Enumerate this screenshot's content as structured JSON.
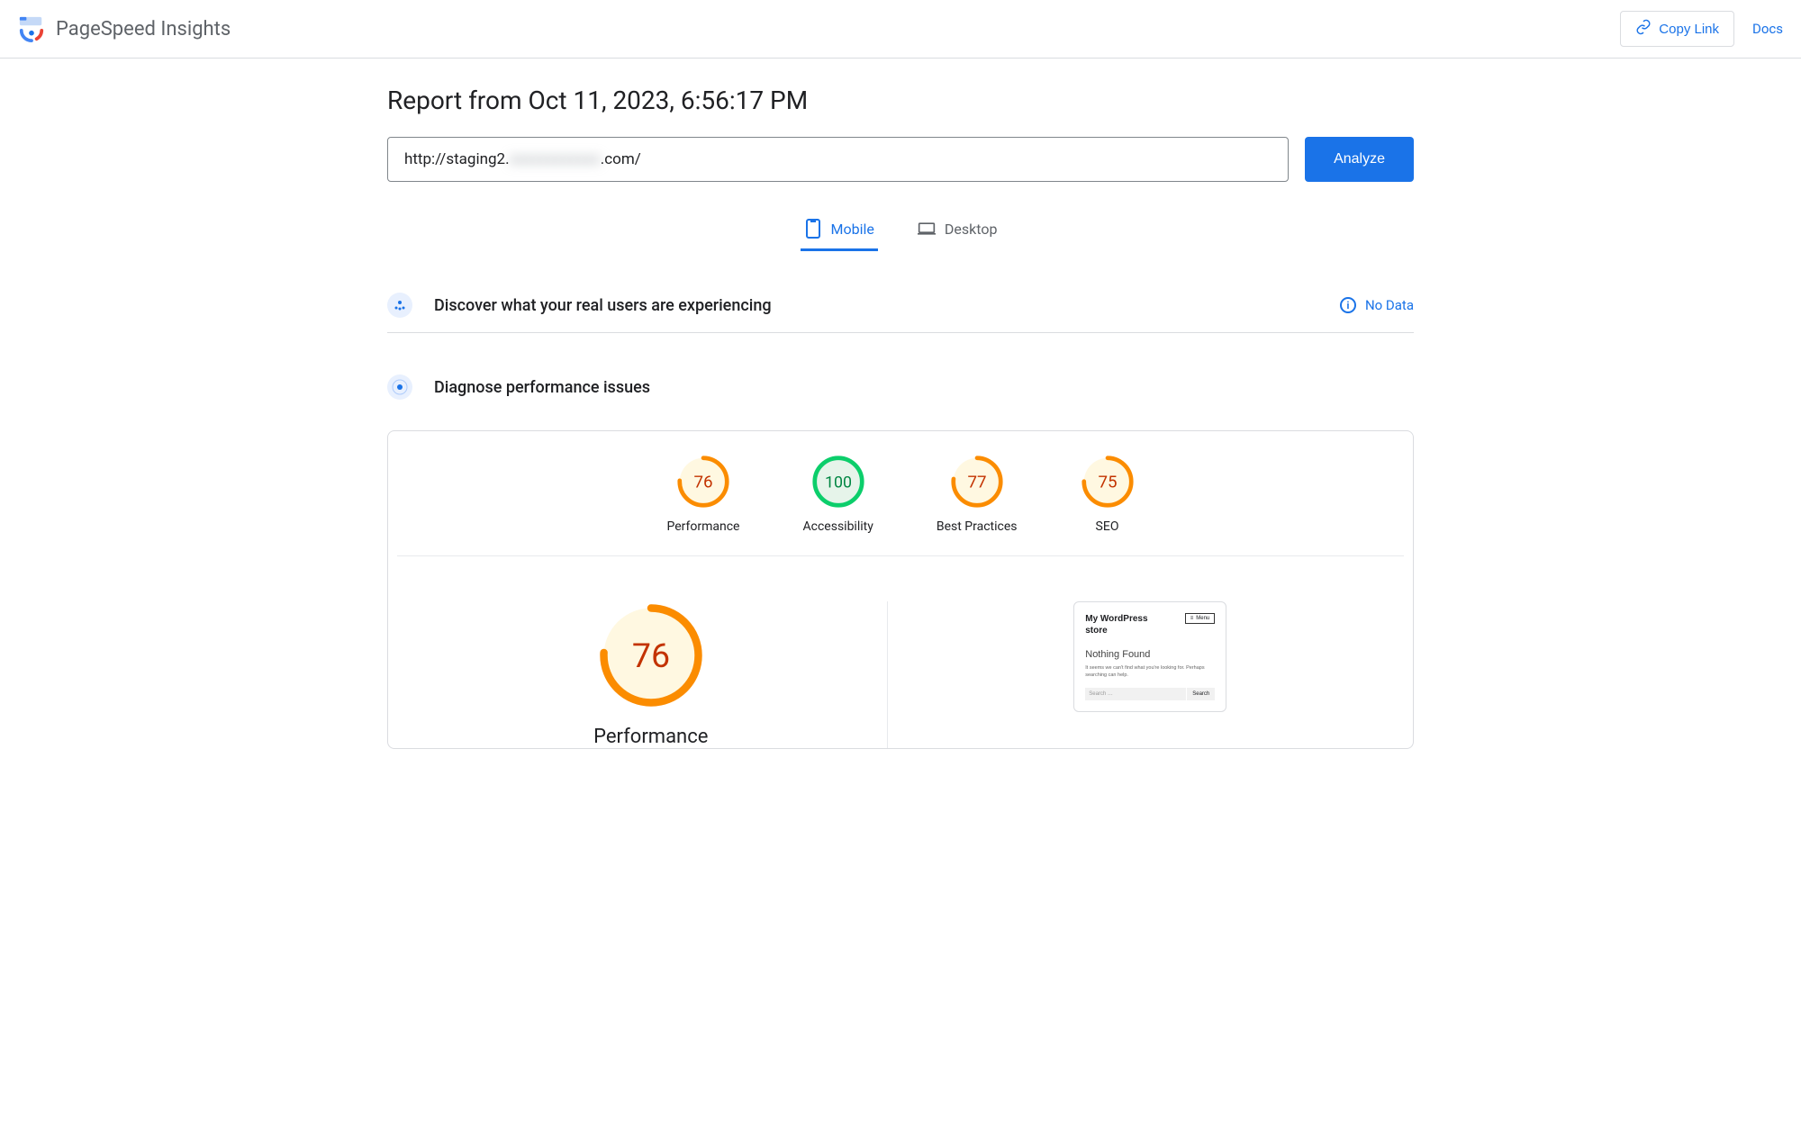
{
  "header": {
    "app_title": "PageSpeed Insights",
    "copy_link": "Copy Link",
    "docs": "Docs"
  },
  "report": {
    "title": "Report from Oct 11, 2023, 6:56:17 PM",
    "url_prefix": "http://staging2.",
    "url_blur": "xxxxxxxxxxxx",
    "url_suffix": ".com/",
    "analyze": "Analyze"
  },
  "tabs": {
    "mobile": "Mobile",
    "desktop": "Desktop"
  },
  "sections": {
    "discover": "Discover what your real users are experiencing",
    "nodata": "No Data",
    "diagnose": "Diagnose performance issues"
  },
  "gauges": {
    "performance": {
      "label": "Performance",
      "score": "76"
    },
    "accessibility": {
      "label": "Accessibility",
      "score": "100"
    },
    "best_practices": {
      "label": "Best Practices",
      "score": "77"
    },
    "seo": {
      "label": "SEO",
      "score": "75"
    }
  },
  "detail": {
    "big_score": "76",
    "big_label": "Performance"
  },
  "preview": {
    "site_title": "My WordPress store",
    "menu": "Menu",
    "nf": "Nothing Found",
    "msg": "It seems we can't find what you're looking for. Perhaps searching can help.",
    "search_placeholder": "Search …",
    "search_btn": "Search"
  },
  "chart_data": [
    {
      "type": "pie",
      "title": "Performance",
      "values": [
        76
      ],
      "ylim": [
        0,
        100
      ]
    },
    {
      "type": "pie",
      "title": "Accessibility",
      "values": [
        100
      ],
      "ylim": [
        0,
        100
      ]
    },
    {
      "type": "pie",
      "title": "Best Practices",
      "values": [
        77
      ],
      "ylim": [
        0,
        100
      ]
    },
    {
      "type": "pie",
      "title": "SEO",
      "values": [
        75
      ],
      "ylim": [
        0,
        100
      ]
    }
  ]
}
